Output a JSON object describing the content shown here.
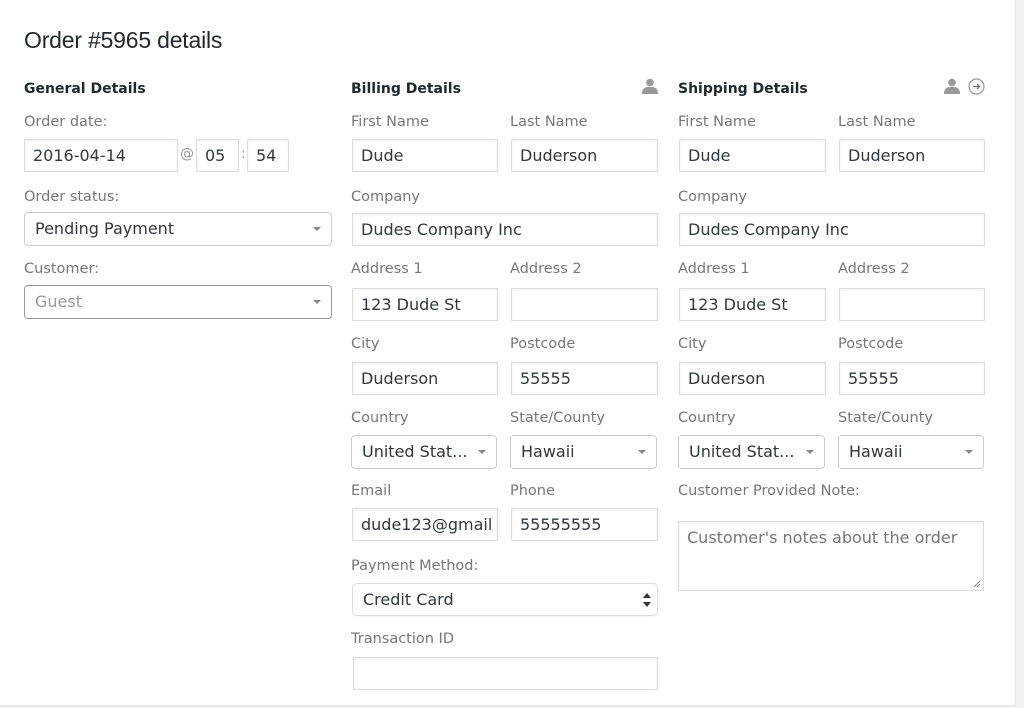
{
  "page": {
    "title": "Order #5965 details"
  },
  "general": {
    "heading": "General Details",
    "order_date_label": "Order date:",
    "order_date_value": "2016-04-14",
    "at_symbol": "@",
    "hour_value": "05",
    "colon": ":",
    "minute_value": "54",
    "order_status_label": "Order status:",
    "order_status_value": "Pending Payment",
    "customer_label": "Customer:",
    "customer_placeholder": "Guest"
  },
  "billing": {
    "heading": "Billing Details",
    "icon": "user-icon",
    "first_name_label": "First Name",
    "first_name_value": "Dude",
    "last_name_label": "Last Name",
    "last_name_value": "Duderson",
    "company_label": "Company",
    "company_value": "Dudes Company Inc",
    "address1_label": "Address 1",
    "address1_value": "123 Dude St",
    "address2_label": "Address 2",
    "address2_value": "",
    "city_label": "City",
    "city_value": "Duderson",
    "postcode_label": "Postcode",
    "postcode_value": "55555",
    "country_label": "Country",
    "country_value": "United Stat...",
    "state_label": "State/County",
    "state_value": "Hawaii",
    "email_label": "Email",
    "email_value": "dude123@gmail",
    "phone_label": "Phone",
    "phone_value": "55555555",
    "payment_method_label": "Payment Method:",
    "payment_method_value": "Credit Card",
    "transaction_id_label": "Transaction ID",
    "transaction_id_value": ""
  },
  "shipping": {
    "heading": "Shipping Details",
    "icons": [
      "user-icon",
      "arrow-right-circle-icon"
    ],
    "first_name_label": "First Name",
    "first_name_value": "Dude",
    "last_name_label": "Last Name",
    "last_name_value": "Duderson",
    "company_label": "Company",
    "company_value": "Dudes Company Inc",
    "address1_label": "Address 1",
    "address1_value": "123 Dude St",
    "address2_label": "Address 2",
    "address2_value": "",
    "city_label": "City",
    "city_value": "Duderson",
    "postcode_label": "Postcode",
    "postcode_value": "55555",
    "country_label": "Country",
    "country_value": "United Stat...",
    "state_label": "State/County",
    "state_value": "Hawaii",
    "note_label": "Customer Provided Note:",
    "note_placeholder": "Customer's notes about the order"
  }
}
